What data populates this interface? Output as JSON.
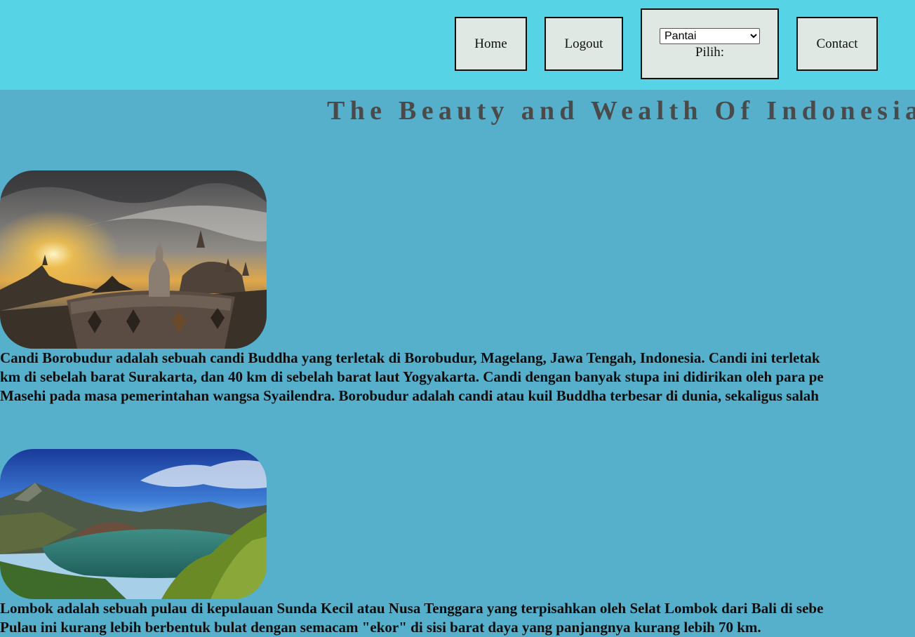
{
  "nav": {
    "home_label": "Home",
    "logout_label": "Logout",
    "contact_label": "Contact",
    "select_value": "Pantai",
    "select_label": "Pilih:"
  },
  "page": {
    "title": "The Beauty and Wealth Of Indonesia"
  },
  "articles": [
    {
      "image_icon": "borobudur-temple-photo",
      "lines": [
        "Candi Borobudur adalah sebuah candi Buddha yang terletak di Borobudur, Magelang, Jawa Tengah, Indonesia. Candi ini terletak",
        "km di sebelah barat Surakarta, dan 40 km di sebelah barat laut Yogyakarta. Candi dengan banyak stupa ini didirikan oleh para pe",
        "Masehi pada masa pemerintahan wangsa Syailendra. Borobudur adalah candi atau kuil Buddha terbesar di dunia, sekaligus salah"
      ]
    },
    {
      "image_icon": "lombok-lake-photo",
      "lines": [
        "Lombok adalah sebuah pulau di kepulauan Sunda Kecil atau Nusa Tenggara yang terpisahkan oleh Selat Lombok dari Bali di sebe",
        "Pulau ini kurang lebih berbentuk bulat dengan semacam \"ekor\" di sisi barat daya yang panjangnya kurang lebih 70 km."
      ]
    }
  ],
  "colors": {
    "header_bg": "#56d4e5",
    "page_bg": "#56b0cc",
    "button_bg": "#e0e8e4",
    "title_color": "#4a4a4a"
  }
}
